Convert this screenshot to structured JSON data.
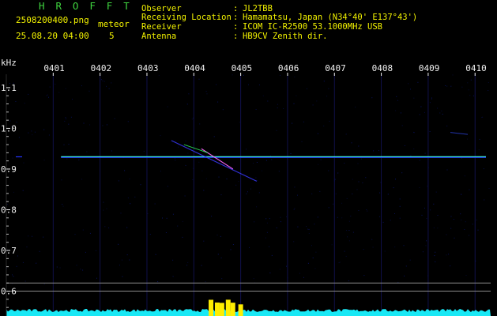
{
  "header": {
    "app_title": "H R O F F T",
    "filename": "2508200400.png",
    "datetime": "25.08.20 04:00",
    "detection_label": "meteor",
    "detection_count": "5",
    "info": [
      {
        "label": "Observer",
        "value": "JL2TBB"
      },
      {
        "label": "Receiving Location",
        "value": "Hamamatsu, Japan (N34°40' E137°43')"
      },
      {
        "label": "Receiver",
        "value": "ICOM IC-R2500 53.1000MHz USB"
      },
      {
        "label": "Antenna",
        "value": "HB9CV Zenith dir."
      }
    ],
    "colon": ":"
  },
  "colors": {
    "title_green": "#3fd43f",
    "label_yellow": "#f2f200",
    "text_white": "#f0f0f0",
    "carrier_cyan": "#3ee6d6",
    "noise_blue": "#2233ff",
    "noise_spectrum": "#18e8f5",
    "meteor_burst": "#ffee00",
    "grid_dark": "#10104a"
  },
  "chart_data": {
    "type": "heatmap",
    "ylabel": "kHz",
    "x_tick_labels": [
      "0401",
      "0402",
      "0403",
      "0404",
      "0405",
      "0406",
      "0407",
      "0408",
      "0409",
      "0410"
    ],
    "y_tick_labels": [
      "1.1",
      "1.0",
      "0.9",
      "0.8",
      "0.7",
      "0.6"
    ],
    "y_ticks": [
      1.1,
      1.0,
      0.9,
      0.8,
      0.7,
      0.6
    ],
    "x_range": [
      "04:00:00",
      "04:10:20"
    ],
    "y_range_khz": [
      0.57,
      1.16
    ],
    "carrier_khz": 0.93,
    "carrier_start": "04:01:10",
    "meteor_echo": {
      "time": "04:04:38",
      "start_khz": 0.97,
      "end_khz": 0.9
    },
    "meteor_count": 5,
    "spectrum_band_khz": [
      0.6,
      0.62
    ],
    "meteor_bursts": [
      "04:04:22",
      "04:04:30",
      "04:04:36",
      "04:04:44",
      "04:04:50",
      "04:05:00"
    ]
  }
}
